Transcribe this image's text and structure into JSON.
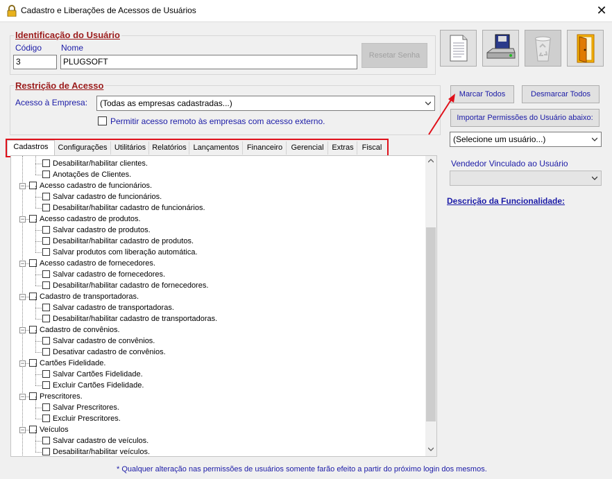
{
  "window": {
    "title": "Cadastro e Liberações de Acessos de Usuários",
    "close_glyph": "✕",
    "icon": "lock-icon"
  },
  "identificacao": {
    "legend": "Identificação do Usuário",
    "codigo_label": "Código",
    "codigo_value": "3",
    "nome_label": "Nome",
    "nome_value": "PLUGSOFT",
    "reset_button": "Resetar Senha"
  },
  "toolbar": {
    "icons": [
      "document-icon",
      "save-disk-icon",
      "recycle-bin-icon",
      "exit-door-icon"
    ]
  },
  "restricao": {
    "legend": "Restrição de Acesso",
    "empresa_label": "Acesso à Empresa:",
    "empresa_value": "(Todas as empresas cadastradas...)",
    "remoto_label": "Permitir acesso remoto às empresas com acesso externo."
  },
  "right_panel": {
    "marcar": "Marcar Todos",
    "desmarcar": "Desmarcar Todos",
    "importar": "Importar Permissões do Usuário abaixo:",
    "usuario_select": "(Selecione um usuário...)",
    "vendedor_label": "Vendedor Vinculado ao Usuário",
    "vendedor_select": "",
    "descricao_link": "Descrição da Funcionalidade:"
  },
  "tabs": [
    "Cadastros",
    "Configurações",
    "Utilitários",
    "Relatórios",
    "Lançamentos",
    "Financeiro",
    "Gerencial",
    "Extras",
    "Fiscal"
  ],
  "tree": [
    {
      "level": 2,
      "label": "Desabilitar/habilitar clientes."
    },
    {
      "level": 2,
      "label": "Anotações de Clientes."
    },
    {
      "level": 1,
      "label": "Acesso cadastro de funcionários."
    },
    {
      "level": 2,
      "label": "Salvar cadastro de funcionários."
    },
    {
      "level": 2,
      "label": "Desabilitar/habilitar cadastro de funcionários."
    },
    {
      "level": 1,
      "label": "Acesso cadastro de produtos."
    },
    {
      "level": 2,
      "label": "Salvar cadastro de produtos."
    },
    {
      "level": 2,
      "label": "Desabilitar/habilitar cadastro de produtos."
    },
    {
      "level": 2,
      "label": "Salvar produtos com liberação automática."
    },
    {
      "level": 1,
      "label": "Acesso cadastro de fornecedores."
    },
    {
      "level": 2,
      "label": "Salvar cadastro de fornecedores."
    },
    {
      "level": 2,
      "label": "Desabilitar/habilitar cadastro de fornecedores."
    },
    {
      "level": 1,
      "label": "Cadastro de transportadoras."
    },
    {
      "level": 2,
      "label": "Salvar cadastro de transportadoras."
    },
    {
      "level": 2,
      "label": "Desabilitar/habilitar cadastro de transportadoras."
    },
    {
      "level": 1,
      "label": "Cadastro de convênios."
    },
    {
      "level": 2,
      "label": "Salvar cadastro de convênios."
    },
    {
      "level": 2,
      "label": "Desativar cadastro de convênios."
    },
    {
      "level": 1,
      "label": "Cartões Fidelidade."
    },
    {
      "level": 2,
      "label": "Salvar Cartões Fidelidade."
    },
    {
      "level": 2,
      "label": "Excluir Cartões Fidelidade."
    },
    {
      "level": 1,
      "label": "Prescritores."
    },
    {
      "level": 2,
      "label": "Salvar Prescritores."
    },
    {
      "level": 2,
      "label": "Excluir Prescritores."
    },
    {
      "level": 1,
      "label": "Veículos"
    },
    {
      "level": 2,
      "label": "Salvar cadastro de veículos."
    },
    {
      "level": 2,
      "label": "Desabilitar/habilitar veículos."
    }
  ],
  "footer": "* Qualquer alteração nas permissões de usuários somente farão efeito a partir do próximo login dos mesmos.",
  "colors": {
    "legend": "#9b1c1c",
    "label_blue": "#1a1aa6",
    "highlight_red": "#e0101a"
  }
}
